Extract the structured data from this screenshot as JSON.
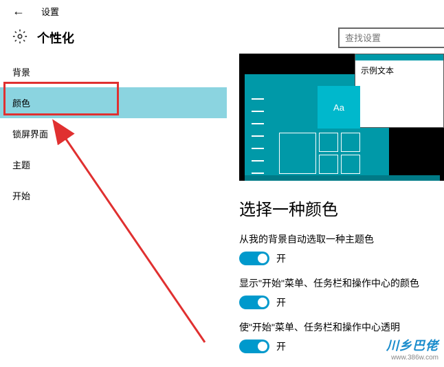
{
  "titlebar": {
    "title": "设置"
  },
  "header": {
    "title": "个性化",
    "search_placeholder": "查找设置"
  },
  "sidebar": {
    "items": [
      {
        "label": "背景"
      },
      {
        "label": "颜色"
      },
      {
        "label": "锁屏界面"
      },
      {
        "label": "主题"
      },
      {
        "label": "开始"
      }
    ]
  },
  "preview": {
    "sample_text": "示例文本",
    "tile_text": "Aa"
  },
  "main": {
    "section_title": "选择一种颜色",
    "settings": [
      {
        "label": "从我的背景自动选取一种主题色",
        "state": "开"
      },
      {
        "label": "显示\"开始\"菜单、任务栏和操作中心的颜色",
        "state": "开"
      },
      {
        "label": "使\"开始\"菜单、任务栏和操作中心透明",
        "state": "开"
      }
    ]
  },
  "watermark": {
    "brand": "川乡巴佬",
    "url": "www.386w.com"
  }
}
